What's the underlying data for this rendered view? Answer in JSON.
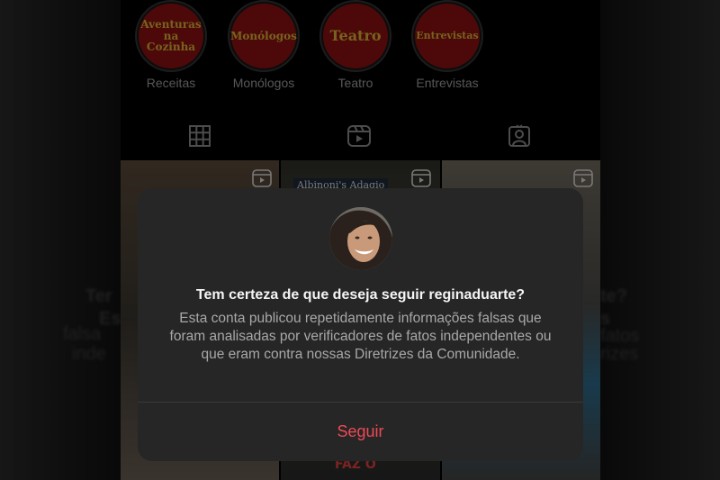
{
  "highlights": [
    {
      "cover_text": "Aventuras na Cozinha",
      "label": "Receitas",
      "icon": "highlight-cover"
    },
    {
      "cover_text": "Monólogos",
      "label": "Monólogos",
      "icon": "highlight-cover"
    },
    {
      "cover_text": "Teatro",
      "label": "Teatro",
      "icon": "highlight-cover"
    },
    {
      "cover_text": "Entrevistas",
      "label": "Entrevistas",
      "icon": "highlight-cover"
    }
  ],
  "tabs": [
    {
      "icon": "grid-icon"
    },
    {
      "icon": "reels-icon"
    },
    {
      "icon": "tagged-icon"
    }
  ],
  "grid": {
    "thumb_caption": "Albinoni's Adagio",
    "bottom_caption": "FAZ O"
  },
  "dialog": {
    "title": "Tem certeza de que deseja seguir reginaduarte?",
    "body": "Esta conta publicou repetidamente informações falsas que foram analisadas por verificadores de fatos independentes ou que eram contra nossas Diretrizes da Comunidade.",
    "follow_label": "Seguir"
  },
  "colors": {
    "accent_red": "#ed4956",
    "dialog_bg": "#262626",
    "highlight_fill": "#8c1111",
    "highlight_text": "#d7b43a"
  }
}
